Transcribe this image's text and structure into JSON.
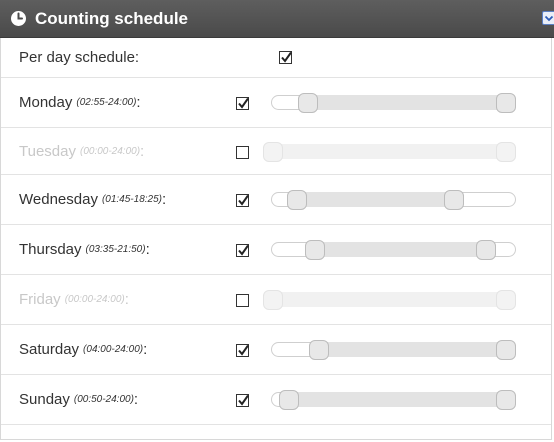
{
  "panel": {
    "title": "Counting schedule",
    "icons": {
      "header": "clock-icon",
      "collapse": "collapse-icon"
    },
    "accent": "#4a4a4a"
  },
  "per_day": {
    "label": "Per day schedule:",
    "checked": true
  },
  "days": [
    {
      "name": "Monday",
      "range": "(02:55-24:00)",
      "checked": true,
      "start": "02:55",
      "end": "24:00",
      "start_fraction": 0.1215,
      "end_fraction": 1.0
    },
    {
      "name": "Tuesday",
      "range": "(00:00-24:00)",
      "checked": false,
      "start": "00:00",
      "end": "24:00",
      "start_fraction": 0.0,
      "end_fraction": 1.0
    },
    {
      "name": "Wednesday",
      "range": "(01:45-18:25)",
      "checked": true,
      "start": "01:45",
      "end": "18:25",
      "start_fraction": 0.0729,
      "end_fraction": 0.7674
    },
    {
      "name": "Thursday",
      "range": "(03:35-21:50)",
      "checked": true,
      "start": "03:35",
      "end": "21:50",
      "start_fraction": 0.1493,
      "end_fraction": 0.9097
    },
    {
      "name": "Friday",
      "range": "(00:00-24:00)",
      "checked": false,
      "start": "00:00",
      "end": "24:00",
      "start_fraction": 0.0,
      "end_fraction": 1.0
    },
    {
      "name": "Saturday",
      "range": "(04:00-24:00)",
      "checked": true,
      "start": "04:00",
      "end": "24:00",
      "start_fraction": 0.1667,
      "end_fraction": 1.0
    },
    {
      "name": "Sunday",
      "range": "(00:50-24:00)",
      "checked": true,
      "start": "00:50",
      "end": "24:00",
      "start_fraction": 0.0347,
      "end_fraction": 1.0
    }
  ],
  "colors": {
    "header_bg": "#4a4a4a",
    "disabled_text": "#c8c8c8",
    "checkbox_border": "#333333",
    "slider_fill": "#e3e3e3"
  }
}
